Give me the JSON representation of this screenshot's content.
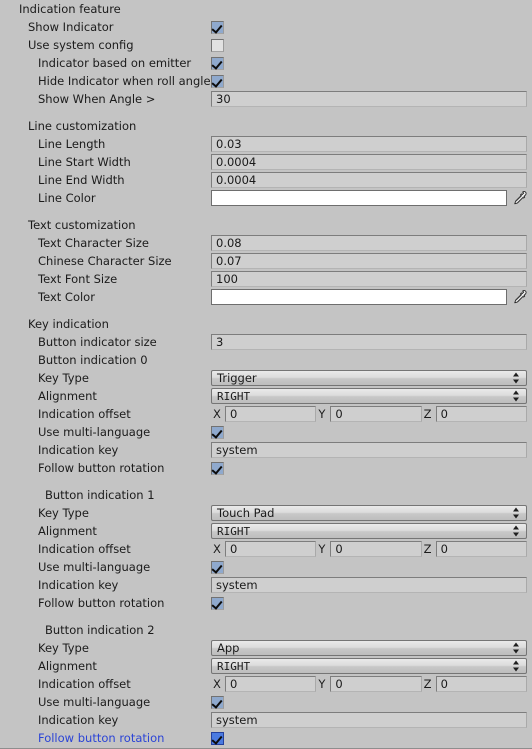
{
  "title": "Indication feature",
  "sections": {
    "indication": {
      "header": "Indication feature",
      "show_indicator": {
        "label": "Show Indicator",
        "checked": true
      },
      "use_system_config": {
        "label": "Use system config",
        "checked": false
      },
      "indicator_based_on_emitter": {
        "label": "Indicator based on emitter",
        "checked": true
      },
      "hide_indicator_when_roll_angle": {
        "label": "Hide Indicator when roll angle",
        "checked": true
      },
      "show_when_angle": {
        "label": "Show When Angle >",
        "value": "30"
      }
    },
    "line": {
      "header": "Line customization",
      "line_length": {
        "label": "Line Length",
        "value": "0.03"
      },
      "line_start_width": {
        "label": "Line Start Width",
        "value": "0.0004"
      },
      "line_end_width": {
        "label": "Line End Width",
        "value": "0.0004"
      },
      "line_color": {
        "label": "Line Color",
        "color": "#ffffff"
      }
    },
    "text": {
      "header": "Text customization",
      "text_character_size": {
        "label": "Text Character Size",
        "value": "0.08"
      },
      "chinese_character_size": {
        "label": "Chinese Character Size",
        "value": "0.07"
      },
      "text_font_size": {
        "label": "Text Font Size",
        "value": "100"
      },
      "text_color": {
        "label": "Text Color",
        "color": "#ffffff"
      }
    },
    "key_indication": {
      "header": "Key indication",
      "button_indicator_size": {
        "label": "Button indicator size",
        "value": "3"
      },
      "field_labels": {
        "key_type": "Key Type",
        "alignment": "Alignment",
        "indication_offset": "Indication offset",
        "use_multi_language": "Use multi-language",
        "indication_key": "Indication key",
        "follow_button_rotation": "Follow button rotation",
        "axis_x": "X",
        "axis_y": "Y",
        "axis_z": "Z"
      },
      "buttons": [
        {
          "header": "Button indication 0",
          "key_type": "Trigger",
          "alignment": "RIGHT",
          "offset": {
            "x": "0",
            "y": "0",
            "z": "0"
          },
          "use_multi_language": true,
          "indication_key": "system",
          "follow_button_rotation": true,
          "follow_focused": false
        },
        {
          "header": "Button indication 1",
          "key_type": "Touch Pad",
          "alignment": "RIGHT",
          "offset": {
            "x": "0",
            "y": "0",
            "z": "0"
          },
          "use_multi_language": true,
          "indication_key": "system",
          "follow_button_rotation": true,
          "follow_focused": false
        },
        {
          "header": "Button indication 2",
          "key_type": "App",
          "alignment": "RIGHT",
          "offset": {
            "x": "0",
            "y": "0",
            "z": "0"
          },
          "use_multi_language": true,
          "indication_key": "system",
          "follow_button_rotation": true,
          "follow_focused": true
        }
      ]
    }
  },
  "colors": {
    "background": "#c4c4c4",
    "field": "#cfcfcf",
    "checkbox_checked": "#8fa9cd",
    "checkbox_focused": "#4a7ae0",
    "link_blue": "#2b44d6"
  },
  "icons": {
    "eyedropper": "eyedropper-icon",
    "dropdown_arrows": "updown-arrows-icon"
  }
}
